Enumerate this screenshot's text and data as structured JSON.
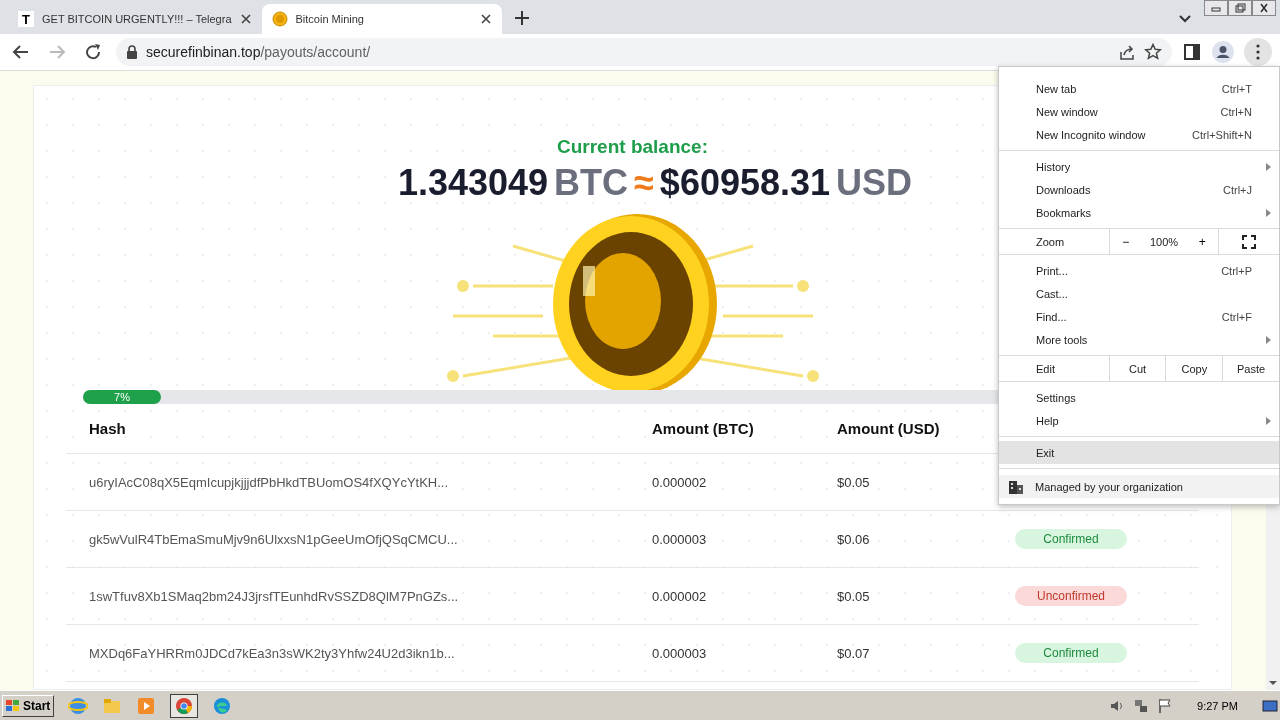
{
  "tabs": [
    {
      "title": "GET BITCOIN URGENTLY!!! – Telegra",
      "kind": "letter",
      "icon_text": "T",
      "selected": false
    },
    {
      "title": "Bitcoin Mining",
      "kind": "coin",
      "selected": true
    }
  ],
  "address": {
    "domain": "securefinbinan.top",
    "path": "/payouts/account/"
  },
  "page": {
    "heading": "Current balance:",
    "balance": {
      "btc_amount": "1.343049",
      "btc_unit": "BTC",
      "approx": "≈",
      "usd_amount": "$60958.31",
      "usd_unit": "USD"
    },
    "progress": {
      "label": "7%",
      "level": 0.07
    },
    "table": {
      "columns": [
        "Hash",
        "Amount (BTC)",
        "Amount (USD)"
      ],
      "rows": [
        {
          "hash": "u6ryIAcC08qX5EqmIcupjkjjjdfPbHkdTBUomOS4fXQYcYtKH...",
          "btc": "0.000002",
          "usd": "$0.05"
        },
        {
          "hash": "gk5wVulR4TbEmaSmuMjv9n6UlxxsN1pGeeUmOfjQSqCMCU...",
          "btc": "0.000003",
          "usd": "$0.06",
          "status": {
            "label": "Confirmed",
            "kind": "confirmed"
          }
        },
        {
          "hash": "1swTfuv8Xb1SMaq2bm24J3jrsfTEunhdRvSSZD8QlM7PnGZs...",
          "btc": "0.000002",
          "usd": "$0.05",
          "status": {
            "label": "Unconfirmed",
            "kind": "unconfirmed"
          }
        },
        {
          "hash": "MXDq6FaYHRRm0JDCd7kEa3n3sWK2ty3Yhfw24U2d3ikn1b...",
          "btc": "0.000003",
          "usd": "$0.07",
          "status": {
            "label": "Confirmed",
            "kind": "confirmed"
          }
        }
      ]
    }
  },
  "menu": {
    "sections": [
      [
        {
          "kind": "item",
          "label": "New tab",
          "shortcut": "Ctrl+T",
          "submenu": false,
          "selected": false
        },
        {
          "kind": "item",
          "label": "New window",
          "shortcut": "Ctrl+N",
          "submenu": false,
          "selected": false
        },
        {
          "kind": "item",
          "label": "New Incognito window",
          "shortcut": "Ctrl+Shift+N",
          "submenu": false,
          "selected": false
        }
      ],
      [
        {
          "kind": "item",
          "label": "History",
          "submenu": true,
          "selected": false
        },
        {
          "kind": "item",
          "label": "Downloads",
          "shortcut": "Ctrl+J",
          "submenu": false,
          "selected": false
        },
        {
          "kind": "item",
          "label": "Bookmarks",
          "submenu": true,
          "selected": false
        }
      ],
      [
        {
          "kind": "zoom",
          "label": "Zoom",
          "minus": "−",
          "value": "100%",
          "plus": "+"
        }
      ],
      [
        {
          "kind": "item",
          "label": "Print...",
          "shortcut": "Ctrl+P",
          "submenu": false,
          "selected": false
        },
        {
          "kind": "item",
          "label": "Cast...",
          "submenu": false,
          "selected": false
        },
        {
          "kind": "item",
          "label": "Find...",
          "shortcut": "Ctrl+F",
          "submenu": false,
          "selected": false
        },
        {
          "kind": "item",
          "label": "More tools",
          "submenu": true,
          "selected": false
        }
      ],
      [
        {
          "kind": "edit",
          "label": "Edit",
          "buttons": [
            "Cut",
            "Copy",
            "Paste"
          ]
        }
      ],
      [
        {
          "kind": "item",
          "label": "Settings",
          "submenu": false,
          "selected": false
        },
        {
          "kind": "item",
          "label": "Help",
          "submenu": true,
          "selected": false
        }
      ],
      [
        {
          "kind": "item",
          "label": "Exit",
          "submenu": false,
          "selected": true
        }
      ],
      [
        {
          "kind": "managed",
          "label": "Managed by your organization"
        }
      ]
    ]
  },
  "taskbar": {
    "start": "Start",
    "clock": "9:27 PM"
  }
}
